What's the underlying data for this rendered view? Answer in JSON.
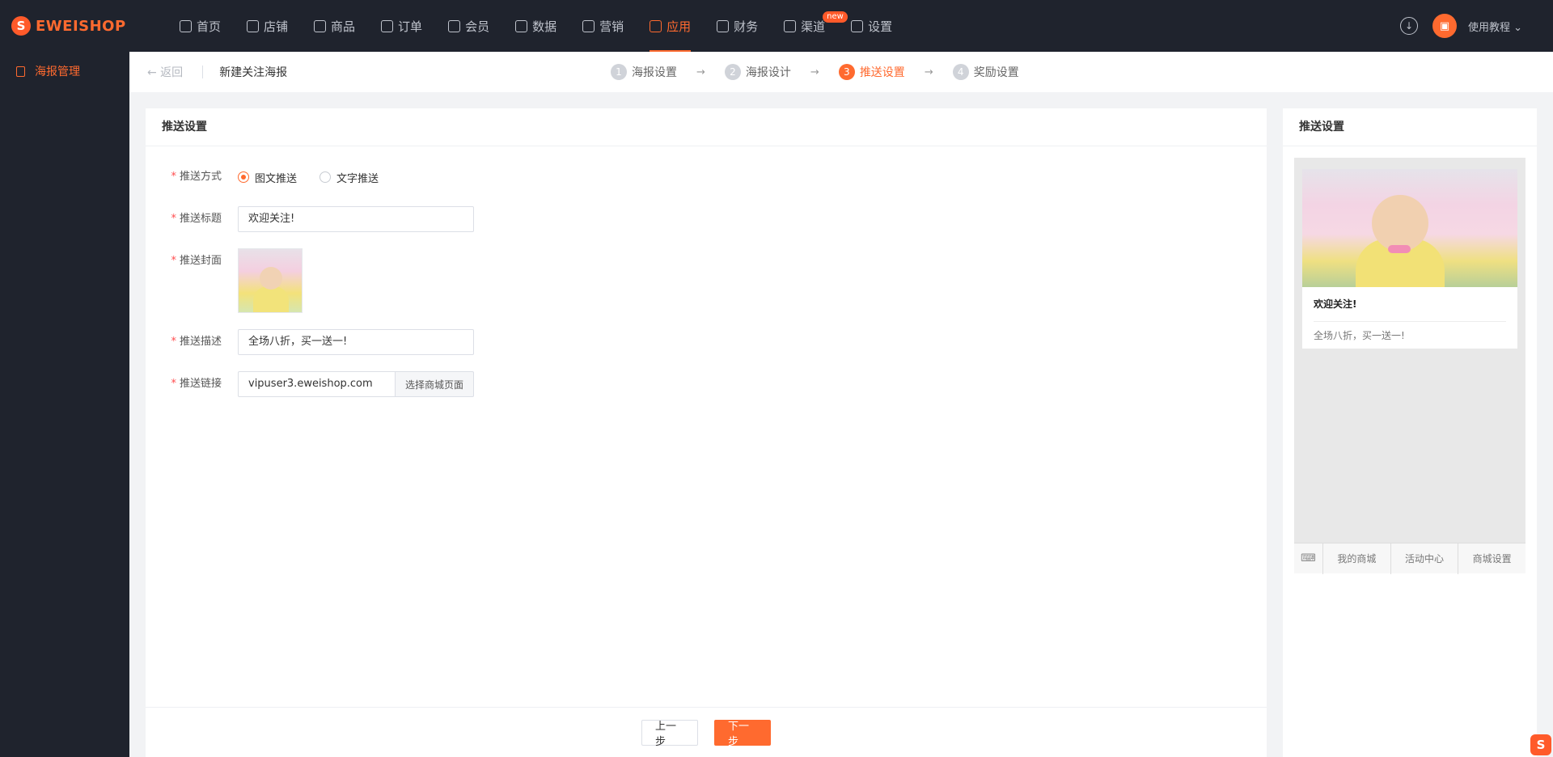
{
  "brand": {
    "logo_text": "EWEISHOP",
    "logo_mark": "S",
    "accent": "#ff6a2f"
  },
  "nav": {
    "items": [
      {
        "label": "首页",
        "icon": "home-icon"
      },
      {
        "label": "店铺",
        "icon": "store-icon"
      },
      {
        "label": "商品",
        "icon": "product-icon"
      },
      {
        "label": "订单",
        "icon": "order-icon"
      },
      {
        "label": "会员",
        "icon": "member-icon"
      },
      {
        "label": "数据",
        "icon": "chart-icon"
      },
      {
        "label": "营销",
        "icon": "tag-icon"
      },
      {
        "label": "应用",
        "icon": "app-icon",
        "active": true
      },
      {
        "label": "财务",
        "icon": "finance-icon"
      },
      {
        "label": "渠道",
        "icon": "channel-icon",
        "badge": "new"
      },
      {
        "label": "设置",
        "icon": "gear-icon"
      }
    ],
    "tutorial": "使用教程 ⌄"
  },
  "sidebar": {
    "items": [
      {
        "label": "海报管理",
        "icon": "poster-icon"
      }
    ]
  },
  "header": {
    "back": "← 返回",
    "title": "新建关注海报",
    "steps": [
      {
        "num": "1",
        "label": "海报设置"
      },
      {
        "num": "2",
        "label": "海报设计"
      },
      {
        "num": "3",
        "label": "推送设置",
        "active": true
      },
      {
        "num": "4",
        "label": "奖励设置"
      }
    ]
  },
  "form": {
    "title": "推送设置",
    "push_type": {
      "label": "推送方式",
      "options": [
        "图文推送",
        "文字推送"
      ],
      "selected": "图文推送"
    },
    "push_title": {
      "label": "推送标题",
      "value": "欢迎关注!"
    },
    "push_cover": {
      "label": "推送封面"
    },
    "push_desc": {
      "label": "推送描述",
      "value": "全场八折，买一送一!"
    },
    "push_link": {
      "label": "推送链接",
      "value": "vipuser3.eweishop.com",
      "button": "选择商城页面"
    }
  },
  "footer": {
    "prev": "上一步",
    "next": "下一步"
  },
  "preview": {
    "title": "推送设置",
    "card_title": "欢迎关注!",
    "card_desc": "全场八折，买一送一!",
    "menu": [
      "我的商城",
      "活动中心",
      "商城设置"
    ]
  }
}
